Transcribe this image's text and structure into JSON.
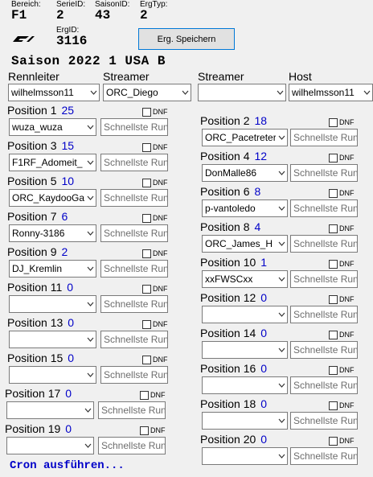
{
  "meta": {
    "bereich_label": "Bereich:",
    "bereich_value": "F1",
    "serie_label": "SerieID:",
    "serie_value": "2",
    "saison_label": "SaisonID:",
    "saison_value": "43",
    "ergtyp_label": "ErgTyp:",
    "ergtyp_value": "2",
    "ergid_label": "ErgID:",
    "ergid_value": "3116"
  },
  "save_button": "Erg. Speichern",
  "title": "Saison 2022 1 USA B",
  "headers": {
    "rennleiter": "Rennleiter",
    "streamer1": "Streamer",
    "streamer2": "Streamer",
    "host": "Host"
  },
  "staff": {
    "rennleiter": "wilhelmsson11",
    "streamer1": "ORC_Diego",
    "streamer2": "",
    "host": "wilhelmsson11"
  },
  "dnf_label": "DNF",
  "fastest_placeholder": "Schnellste Runde",
  "positions": [
    {
      "label": "Position 1",
      "points": "25",
      "driver": "wuza_wuza"
    },
    {
      "label": "Position 2",
      "points": "18",
      "driver": "ORC_Pacetreter"
    },
    {
      "label": "Position 3",
      "points": "15",
      "driver": "F1RF_Adomeit_"
    },
    {
      "label": "Position 4",
      "points": "12",
      "driver": "DonMalle86"
    },
    {
      "label": "Position 5",
      "points": "10",
      "driver": "ORC_KaydooGa"
    },
    {
      "label": "Position 6",
      "points": "8",
      "driver": "p-vantoledo"
    },
    {
      "label": "Position 7",
      "points": "6",
      "driver": "Ronny-3186"
    },
    {
      "label": "Position 8",
      "points": "4",
      "driver": "ORC_James_H"
    },
    {
      "label": "Position 9",
      "points": "2",
      "driver": "DJ_Kremlin"
    },
    {
      "label": "Position 10",
      "points": "1",
      "driver": "xxFWSCxx"
    },
    {
      "label": "Position 11",
      "points": "0",
      "driver": ""
    },
    {
      "label": "Position 12",
      "points": "0",
      "driver": ""
    },
    {
      "label": "Position 13",
      "points": "0",
      "driver": ""
    },
    {
      "label": "Position 14",
      "points": "0",
      "driver": ""
    },
    {
      "label": "Position 15",
      "points": "0",
      "driver": ""
    },
    {
      "label": "Position 16",
      "points": "0",
      "driver": ""
    },
    {
      "label": "Position 17",
      "points": "0",
      "driver": ""
    },
    {
      "label": "Position 18",
      "points": "0",
      "driver": ""
    },
    {
      "label": "Position 19",
      "points": "0",
      "driver": ""
    },
    {
      "label": "Position 20",
      "points": "0",
      "driver": ""
    }
  ],
  "footer": "Cron ausführen...",
  "icons": {
    "logo": "f1-logo-icon",
    "dropdown": "chevron-down-icon",
    "checkbox": "checkbox-icon"
  },
  "colors": {
    "points": "#0000c8",
    "footer": "#0000c8",
    "button_border": "#0078d7"
  }
}
